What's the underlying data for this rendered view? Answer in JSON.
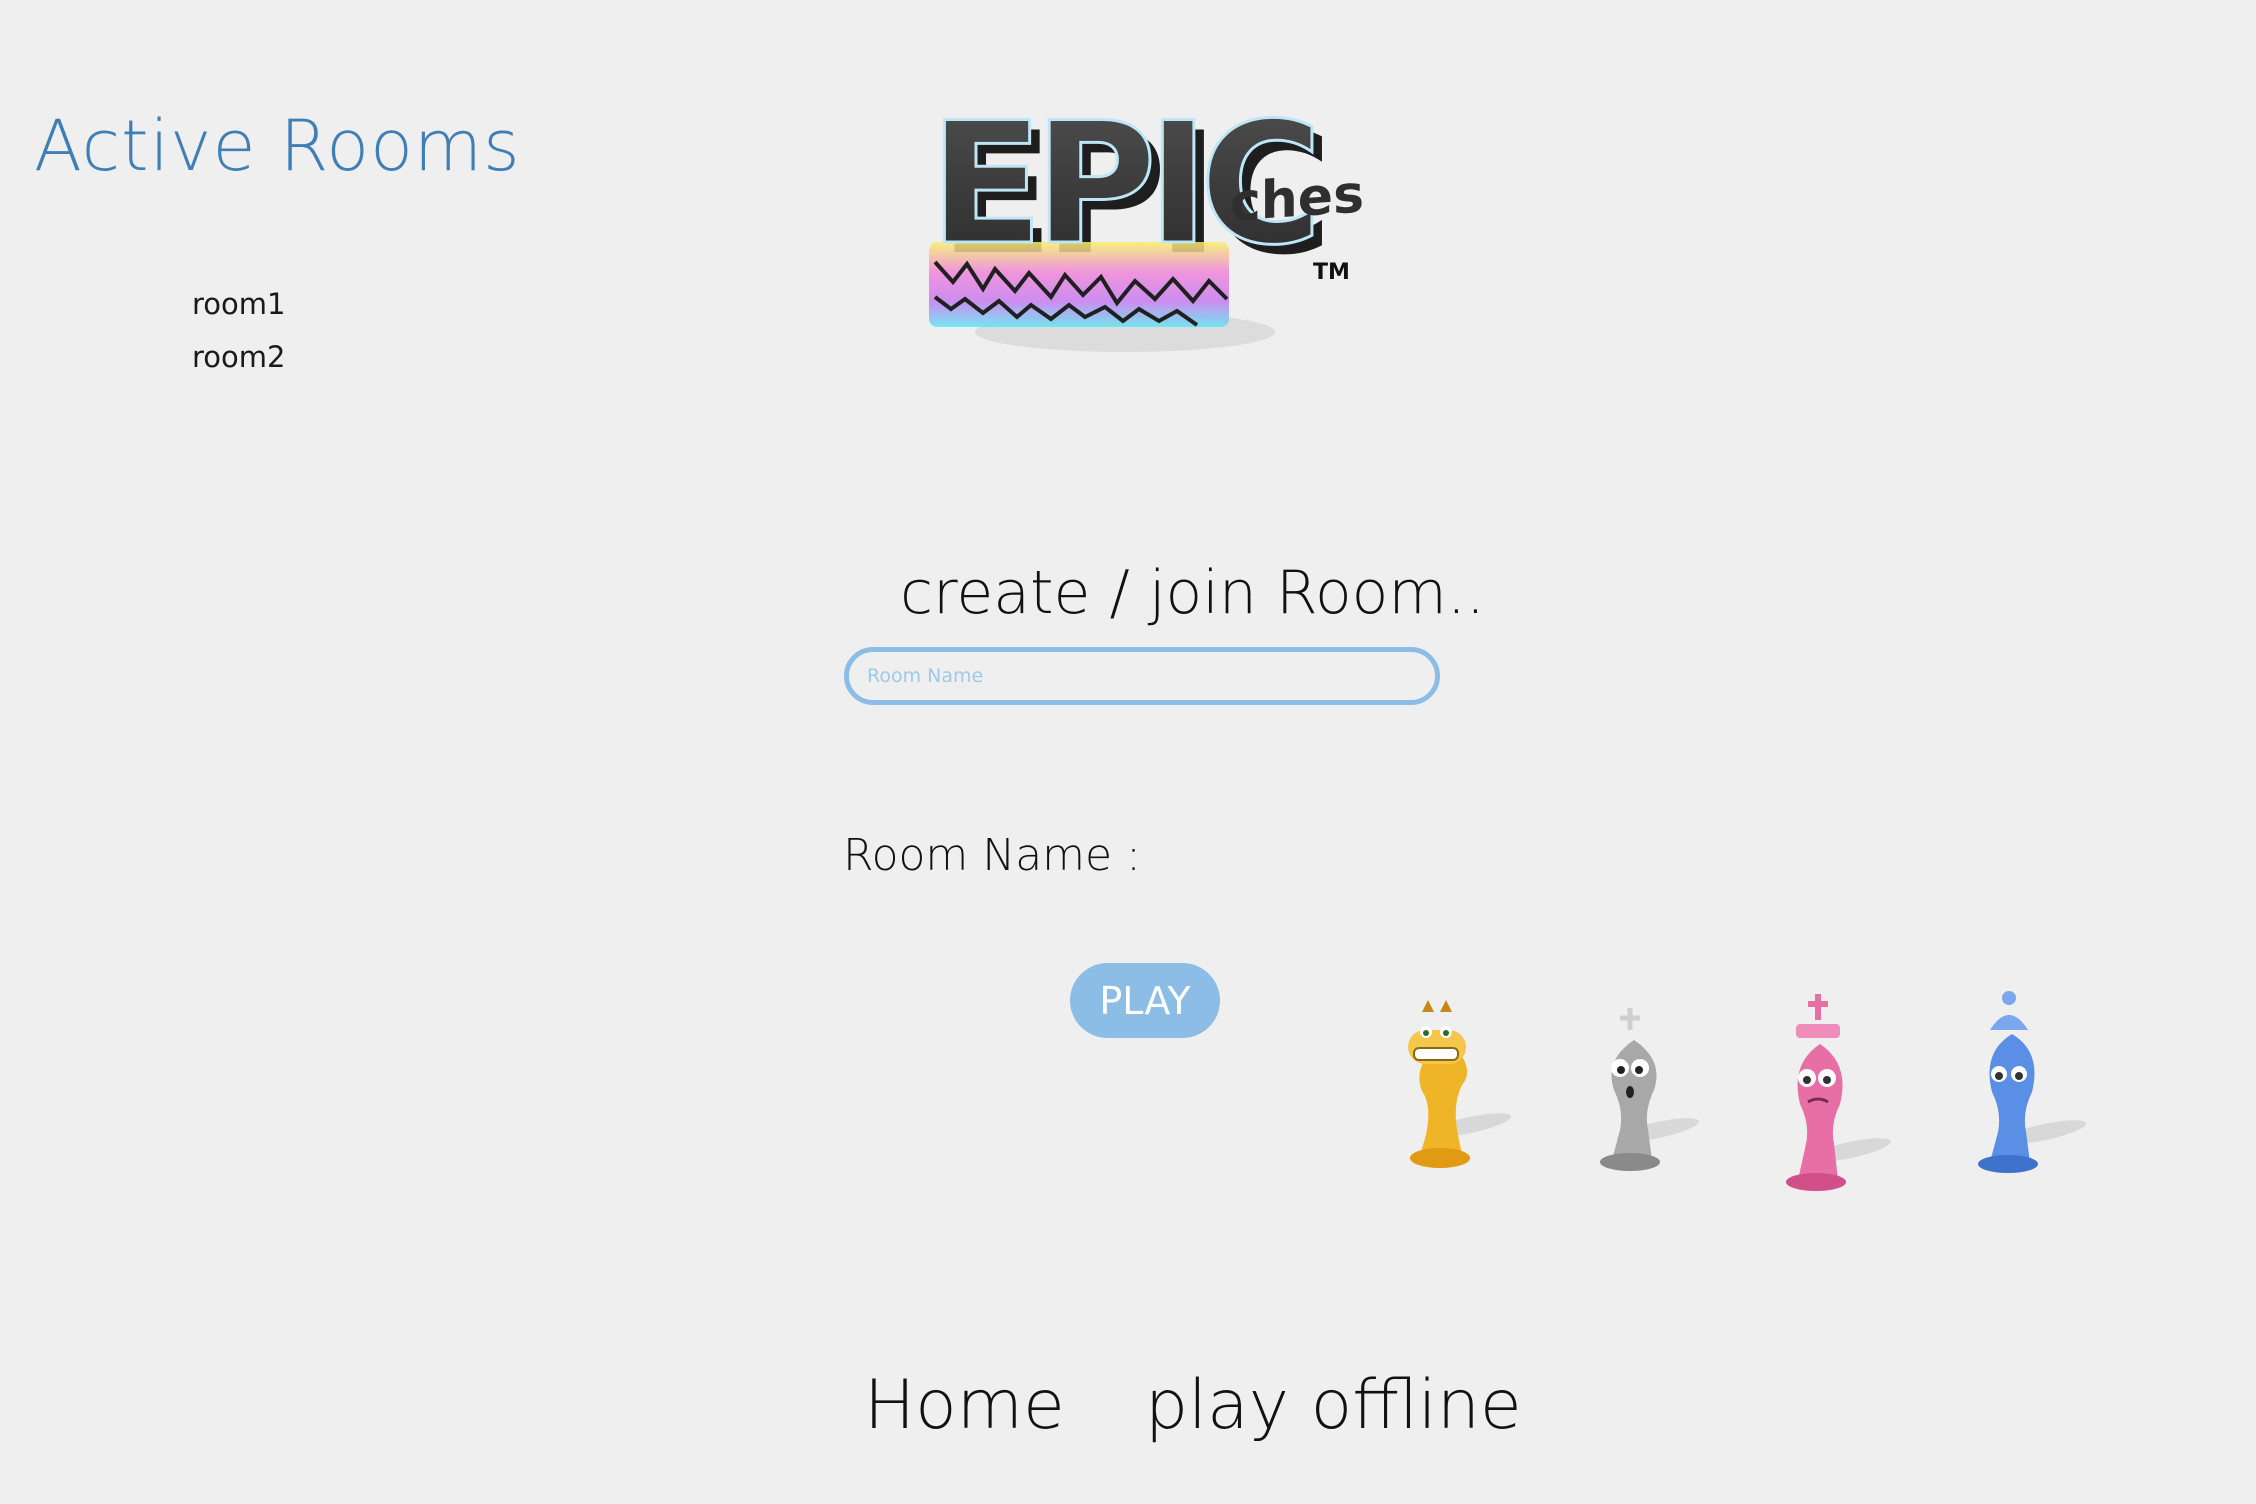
{
  "sidebar": {
    "title": "Active Rooms",
    "rooms": [
      {
        "label": "room1"
      },
      {
        "label": "room2"
      }
    ]
  },
  "logo": {
    "main_text": "EPIC",
    "sub_text": "chess",
    "trademark": "TM"
  },
  "form": {
    "title": "create / join Room..",
    "input_placeholder": "Room Name",
    "input_value": "",
    "room_name_label": "Room Name :",
    "room_name_value": "",
    "play_label": "PLAY"
  },
  "pieces": [
    {
      "name": "knight-icon",
      "color": "#f0b428"
    },
    {
      "name": "bishop-icon",
      "color": "#9a9a9a"
    },
    {
      "name": "king-icon",
      "color": "#e76fa5"
    },
    {
      "name": "queen-icon",
      "color": "#5b8fe6"
    }
  ],
  "footer": {
    "home_label": "Home",
    "offline_label": "play offline"
  },
  "colors": {
    "accent": "#3f7fb6",
    "button": "#8bbde6",
    "background": "#efefef"
  }
}
